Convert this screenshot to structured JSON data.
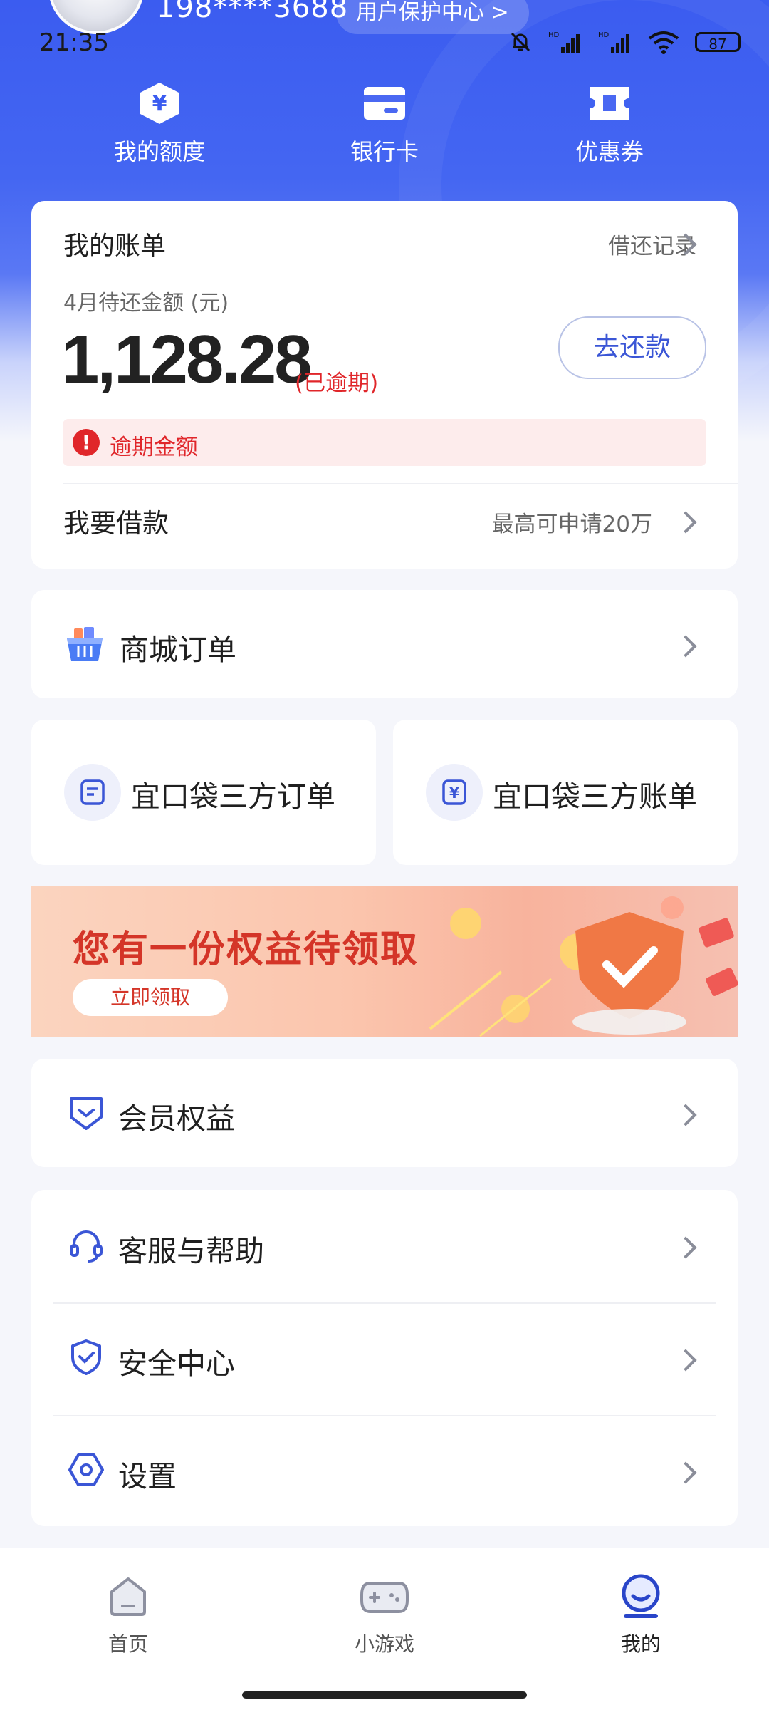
{
  "status_bar": {
    "time": "21:35",
    "battery": "87"
  },
  "profile": {
    "phone": "198****3688",
    "protect_center_label": "用户保护中心",
    "protect_center_arrow": ">"
  },
  "quick_actions": [
    {
      "label": "我的额度",
      "icon": "yuan-shield-icon"
    },
    {
      "label": "银行卡",
      "icon": "bank-card-icon"
    },
    {
      "label": "优惠券",
      "icon": "coupon-icon"
    }
  ],
  "bill": {
    "title": "我的账单",
    "record_label": "借还记录",
    "subtitle": "4月待还金额 (元)",
    "amount": "1,128.28",
    "overdue_tag": "(已逾期)",
    "repay_button": "去还款",
    "overdue_notice": "逾期金额",
    "overdue_icon_text": "!",
    "loan_title": "我要借款",
    "loan_hint": "最高可申请20万"
  },
  "mall_order": {
    "label": "商城订单",
    "icon": "shopping-basket-icon"
  },
  "third_party": [
    {
      "label": "宜口袋三方订单",
      "icon": "order-doc-icon"
    },
    {
      "label": "宜口袋三方账单",
      "icon": "yuan-bill-icon"
    }
  ],
  "banner": {
    "title": "您有一份权益待领取",
    "button": "立即领取"
  },
  "member": {
    "label": "会员权益",
    "icon": "member-badge-icon"
  },
  "services": [
    {
      "label": "客服与帮助",
      "icon": "headset-icon"
    },
    {
      "label": "安全中心",
      "icon": "shield-check-icon"
    },
    {
      "label": "设置",
      "icon": "settings-hex-icon"
    }
  ],
  "bottom_nav": [
    {
      "label": "首页",
      "icon": "home-icon"
    },
    {
      "label": "小游戏",
      "icon": "gamepad-icon"
    },
    {
      "label": "我的",
      "icon": "profile-face-icon",
      "active": true
    }
  ],
  "colors": {
    "brand_blue": "#3b5cf0",
    "overdue_red": "#e0262a",
    "link_blue": "#3b56d6"
  }
}
